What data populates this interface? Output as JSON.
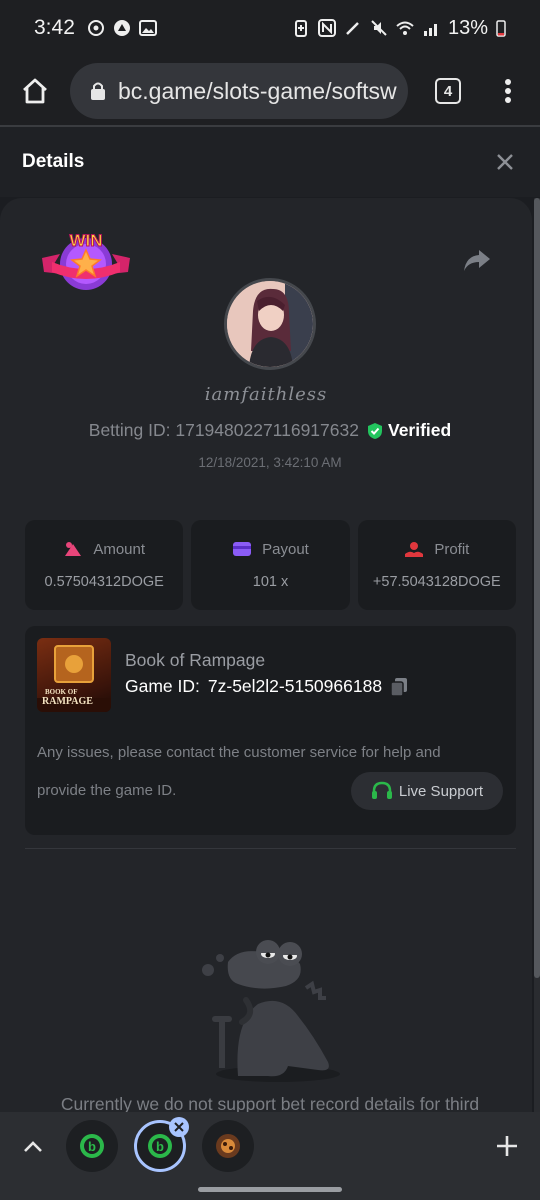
{
  "status_bar": {
    "time": "3:42",
    "battery": "13%"
  },
  "browser": {
    "url": "bc.game/slots-game/softsw",
    "tab_count": "4"
  },
  "header": {
    "title": "Details"
  },
  "bet": {
    "username": "iamfaithless",
    "betting_id_label": "Betting ID: 1719480227116917632",
    "verified_label": "Verified",
    "timestamp": "12/18/2021, 3:42:10 AM",
    "win_label": "WIN"
  },
  "stats": {
    "amount_label": "Amount",
    "amount_value": "0.57504312DOGE",
    "payout_label": "Payout",
    "payout_value": "101 x",
    "profit_label": "Profit",
    "profit_value": "+57.5043128DOGE"
  },
  "game": {
    "name": "Book of Rampage",
    "game_id_label": "Game ID:",
    "game_id_value": "7z-5el2l2-5150966188",
    "thumb_text_1": "BOOK OF",
    "thumb_text_2": "RAMPAGE",
    "note_line_1": "Any issues, please contact the customer service for help and",
    "note_line_2": "provide the game ID.",
    "live_support_label": "Live Support"
  },
  "notice": "Currently we do not support bet record details for third",
  "colors": {
    "accent_green": "#2bb84a",
    "verified_green": "#22c55e",
    "profit_red": "#e0373d",
    "payout_purple": "#8b5cf6",
    "amount_pink": "#e8457a"
  }
}
